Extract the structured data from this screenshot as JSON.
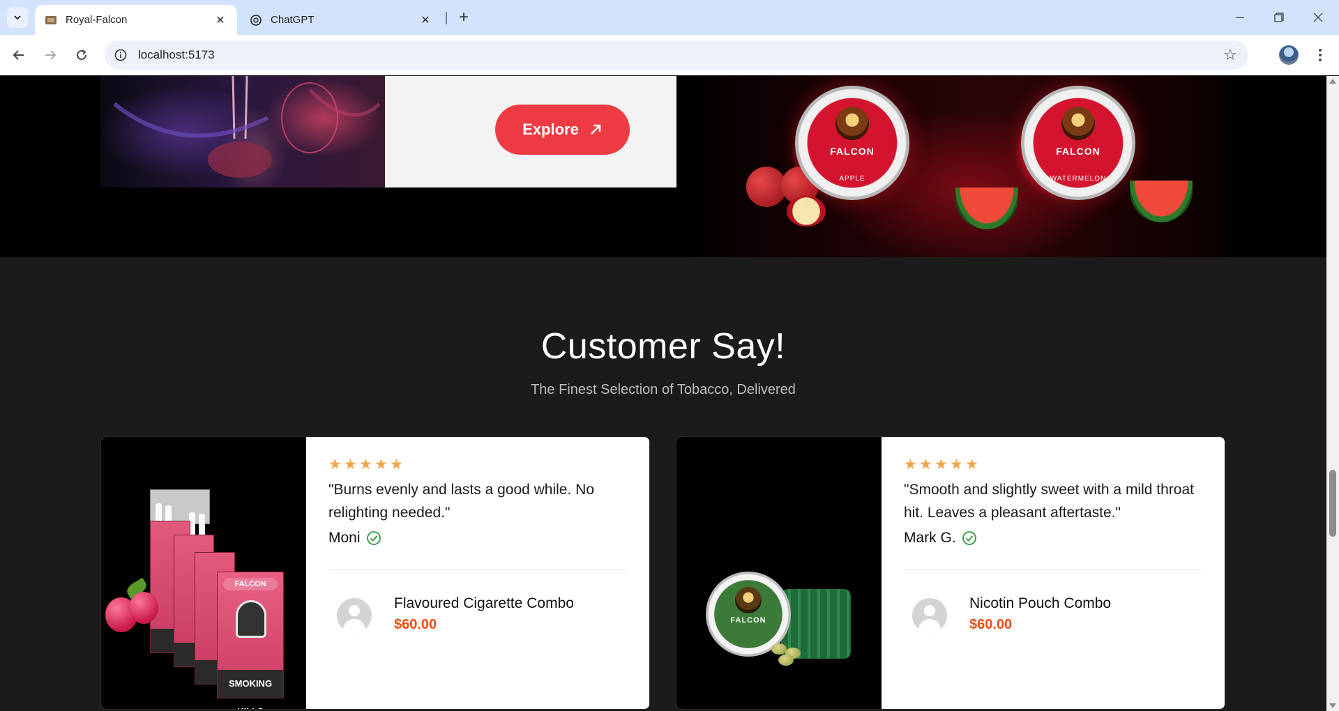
{
  "browser": {
    "tabs": [
      {
        "title": "Royal-Falcon",
        "active": true
      },
      {
        "title": "ChatGPT",
        "active": false
      }
    ],
    "url": "localhost:5173"
  },
  "hero": {
    "explore_label": "Explore",
    "tins": [
      {
        "brand": "FALCON",
        "flavor": "APPLE"
      },
      {
        "brand": "FALCON",
        "flavor": "WATERMELON"
      }
    ]
  },
  "section": {
    "title": "Customer Say!",
    "subtitle": "The Finest Selection of Tobacco, Delivered"
  },
  "reviews": [
    {
      "rating": 5,
      "quote": "\"Burns evenly and lasts a good while. No relighting needed.\"",
      "reviewer": "Moni",
      "product_name": "Flavoured Cigarette Combo",
      "price": "$60.00",
      "pack_brand": "FALCON",
      "pack_warning": "SMOKING KILLS"
    },
    {
      "rating": 5,
      "quote": "\"Smooth and slightly sweet with a mild throat hit. Leaves a pleasant aftertaste.\"",
      "reviewer": "Mark G.",
      "product_name": "Nicotin Pouch Combo",
      "price": "$60.00",
      "tin_brand": "FALCON"
    }
  ],
  "colors": {
    "accent": "#ee3a43",
    "price": "#ef4d12",
    "star": "#f2a54a",
    "verified": "#2e9b3a",
    "page_bg": "#1b1b1b"
  }
}
